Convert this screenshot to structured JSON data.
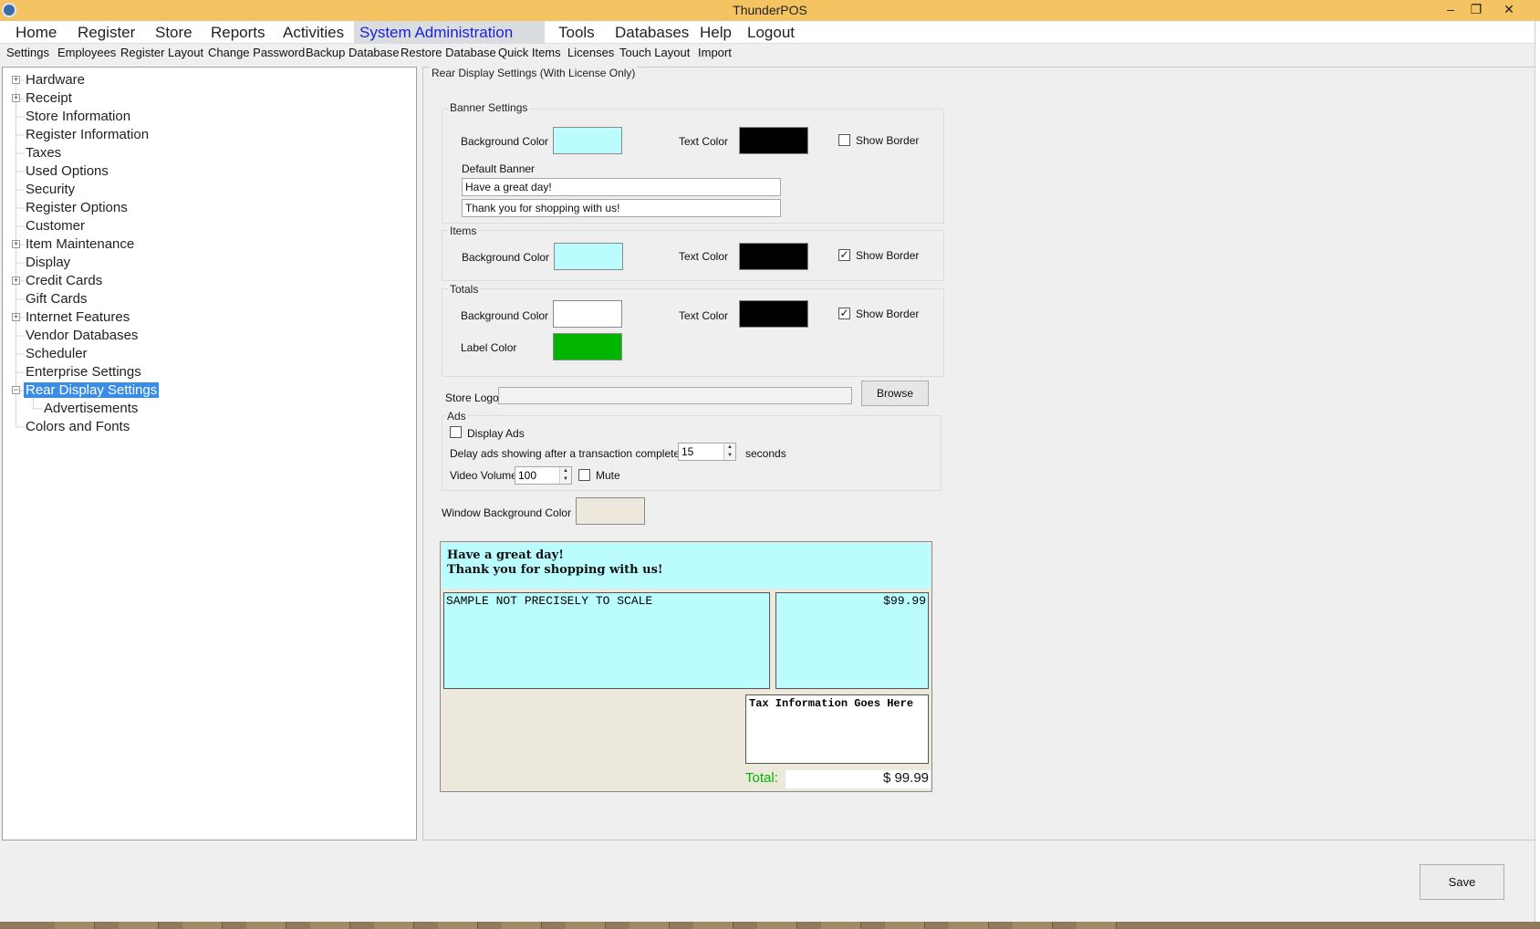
{
  "window": {
    "title": "ThunderPOS",
    "minimize_glyph": "‒",
    "restore_glyph": "❐",
    "close_glyph": "✕",
    "accent_color": "#f4c362"
  },
  "main_menu": {
    "items": [
      "Home",
      "Register",
      "Store",
      "Reports",
      "Activities",
      "System Administration",
      "Tools",
      "Databases",
      "Help",
      "Logout"
    ],
    "active": "System Administration",
    "active_color": "#1e22d6"
  },
  "sub_menu": {
    "items": [
      "Settings",
      "Employees",
      "Register Layout",
      "Change Password",
      "Backup Database",
      "Restore Database",
      "Quick Items",
      "Licenses",
      "Touch Layout",
      "Import"
    ]
  },
  "tree": {
    "items": [
      {
        "label": "Hardware",
        "expandable": true,
        "glyph": "+"
      },
      {
        "label": "Receipt",
        "expandable": true,
        "glyph": "+"
      },
      {
        "label": "Store Information",
        "expandable": false
      },
      {
        "label": "Register Information",
        "expandable": false
      },
      {
        "label": "Taxes",
        "expandable": false
      },
      {
        "label": "Used Options",
        "expandable": false
      },
      {
        "label": "Security",
        "expandable": false
      },
      {
        "label": "Register Options",
        "expandable": false
      },
      {
        "label": "Customer",
        "expandable": false
      },
      {
        "label": "Item Maintenance",
        "expandable": true,
        "glyph": "+"
      },
      {
        "label": "Display",
        "expandable": false
      },
      {
        "label": "Credit Cards",
        "expandable": true,
        "glyph": "+"
      },
      {
        "label": "Gift Cards",
        "expandable": false
      },
      {
        "label": "Internet Features",
        "expandable": true,
        "glyph": "+"
      },
      {
        "label": "Vendor Databases",
        "expandable": false
      },
      {
        "label": "Scheduler",
        "expandable": false
      },
      {
        "label": "Enterprise Settings",
        "expandable": false
      },
      {
        "label": "Rear Display Settings",
        "expandable": true,
        "glyph": "−",
        "selected": true
      },
      {
        "label": "Advertisements",
        "expandable": false,
        "child": true
      },
      {
        "label": "Colors and Fonts",
        "expandable": false
      }
    ],
    "selected_color": "#3a8de6"
  },
  "settings": {
    "panel_title": "Rear Display Settings (With License Only)",
    "banner": {
      "legend": "Banner Settings",
      "background_label": "Background Color",
      "background_color": "#bbfcfe",
      "text_label": "Text Color",
      "text_color": "#000000",
      "show_border_label": "Show Border",
      "show_border": false,
      "default_banner_label": "Default Banner",
      "line1": "Have a great day!",
      "line2": "Thank you for shopping with us!"
    },
    "items": {
      "legend": "Items",
      "background_label": "Background Color",
      "background_color": "#bbfcfe",
      "text_label": "Text Color",
      "text_color": "#000000",
      "show_border_label": "Show Border",
      "show_border": true
    },
    "totals": {
      "legend": "Totals",
      "background_label": "Background Color",
      "background_color": "#ffffff",
      "text_label": "Text Color",
      "text_color": "#000000",
      "show_border_label": "Show Border",
      "show_border": true,
      "label_color_label": "Label Color",
      "label_color": "#00b400"
    },
    "store_logo": {
      "label": "Store Logo",
      "value": "",
      "browse_label": "Browse"
    },
    "ads": {
      "legend": "Ads",
      "display_ads_label": "Display Ads",
      "display_ads": false,
      "delay_label": "Delay ads showing after a transaction completed for",
      "delay_value": "15",
      "delay_unit": "seconds",
      "volume_label": "Video Volume",
      "volume_value": "100",
      "mute_label": "Mute",
      "mute": false
    },
    "window_bg": {
      "label": "Window Background Color",
      "color": "#ece9dc"
    }
  },
  "preview": {
    "banner_line1": "Have a great day!",
    "banner_line2": "Thank you for shopping with us!",
    "items_text": "SAMPLE NOT PRECISELY TO SCALE",
    "price_text": "$99.99",
    "tax_text": "Tax Information Goes Here",
    "total_label": "Total:",
    "total_value": "$ 99.99"
  },
  "footer": {
    "save_label": "Save"
  },
  "check_glyph": "✓"
}
